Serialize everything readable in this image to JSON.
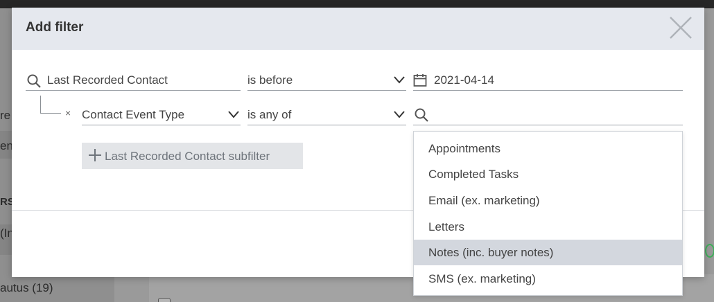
{
  "background": {
    "sidebar_items": [
      "re",
      "en",
      "RS",
      "(In",
      "autus (19)"
    ]
  },
  "modal": {
    "title": "Add filter",
    "rows": [
      {
        "field": "Last Recorded Contact",
        "operator": "is before",
        "value": "2021-04-14"
      },
      {
        "field": "Contact Event Type",
        "operator": "is any of",
        "value": ""
      }
    ],
    "remove_glyph": "×",
    "subfilter_button": "Last Recorded Contact subfilter",
    "dropdown": {
      "options": [
        "Appointments",
        "Completed Tasks",
        "Email (ex. marketing)",
        "Letters",
        "Notes (inc. buyer notes)",
        "SMS (ex. marketing)"
      ],
      "highlighted": "Notes (inc. buyer notes)"
    }
  },
  "colors": {
    "header_bg": "#e5e8ee",
    "highlight_bg": "#d3d7de",
    "accent_blue": "#1f6fe0"
  }
}
